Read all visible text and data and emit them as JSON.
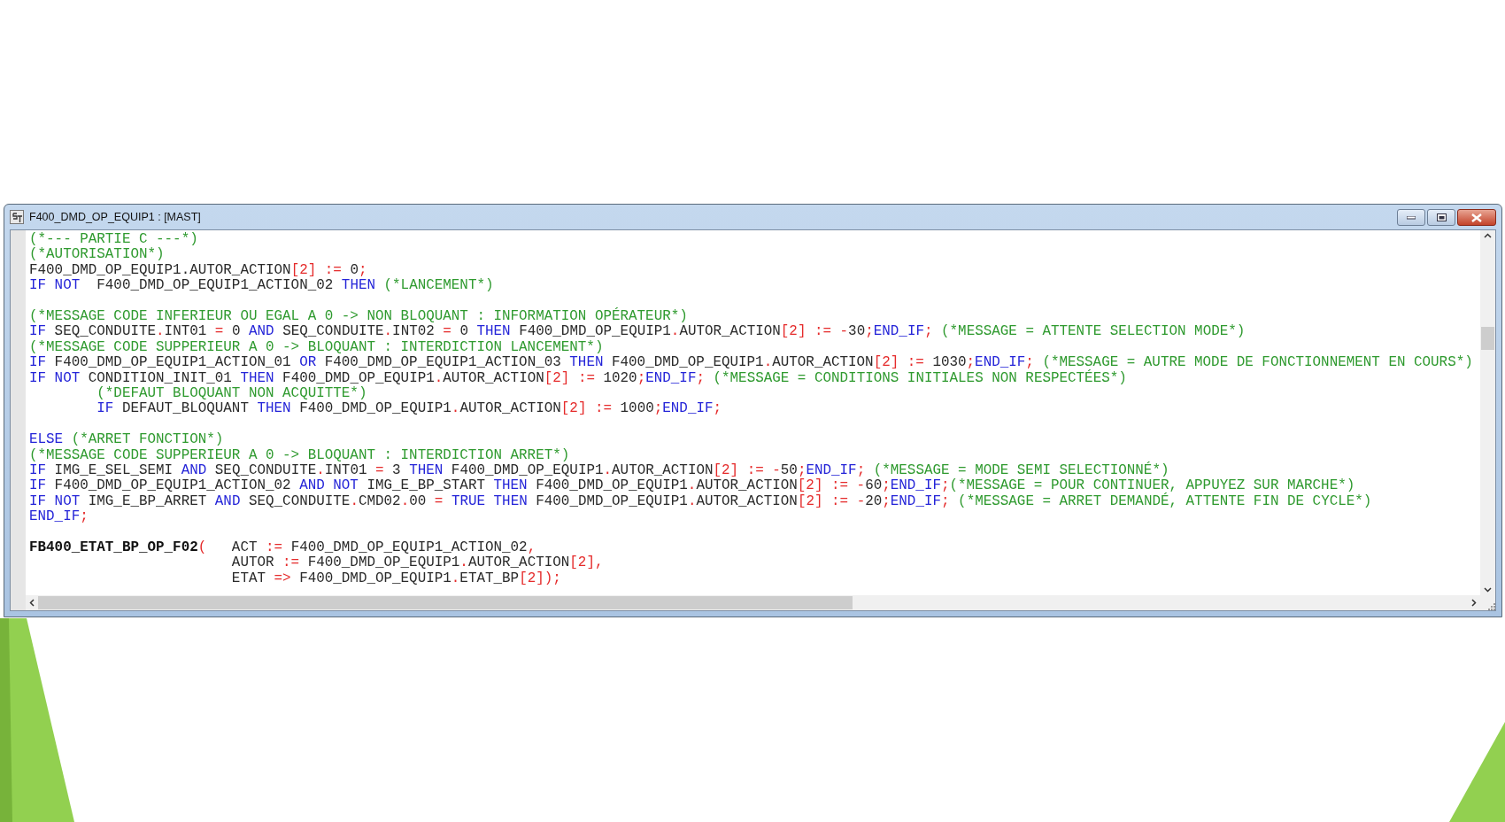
{
  "window": {
    "title": "F400_DMD_OP_EQUIP1 : [MAST]"
  },
  "editor": {
    "lines": [
      {
        "kind": "code",
        "tokens": [
          {
            "kind": "cm",
            "text": "(*--- PARTIE C ---*)"
          }
        ]
      },
      {
        "kind": "code",
        "tokens": [
          {
            "kind": "cm",
            "text": "(*AUTORISATION*)"
          }
        ]
      },
      {
        "kind": "code",
        "tokens": [
          {
            "kind": "id",
            "text": "F400_DMD_OP_EQUIP1.AUTOR_ACTION"
          },
          {
            "kind": "op",
            "text": "[2] := "
          },
          {
            "kind": "id",
            "text": "0"
          },
          {
            "kind": "op",
            "text": ";"
          }
        ]
      },
      {
        "kind": "code",
        "tokens": [
          {
            "kind": "kw",
            "text": "IF NOT  "
          },
          {
            "kind": "id",
            "text": "F400_DMD_OP_EQUIP1_ACTION_02 "
          },
          {
            "kind": "kw",
            "text": "THEN "
          },
          {
            "kind": "cm",
            "text": "(*LANCEMENT*)"
          }
        ]
      },
      {
        "kind": "blank"
      },
      {
        "kind": "code",
        "tokens": [
          {
            "kind": "cm",
            "text": "(*MESSAGE CODE INFERIEUR OU EGAL A 0 -> NON BLOQUANT : INFORMATION OPÉRATEUR*)"
          }
        ]
      },
      {
        "kind": "code",
        "tokens": [
          {
            "kind": "kw",
            "text": "IF "
          },
          {
            "kind": "id",
            "text": "SEQ_CONDUITE"
          },
          {
            "kind": "op",
            "text": "."
          },
          {
            "kind": "id",
            "text": "INT01 "
          },
          {
            "kind": "op",
            "text": "= "
          },
          {
            "kind": "id",
            "text": "0 "
          },
          {
            "kind": "kw",
            "text": "AND "
          },
          {
            "kind": "id",
            "text": "SEQ_CONDUITE"
          },
          {
            "kind": "op",
            "text": "."
          },
          {
            "kind": "id",
            "text": "INT02 "
          },
          {
            "kind": "op",
            "text": "= "
          },
          {
            "kind": "id",
            "text": "0 "
          },
          {
            "kind": "kw",
            "text": "THEN "
          },
          {
            "kind": "id",
            "text": "F400_DMD_OP_EQUIP1"
          },
          {
            "kind": "op",
            "text": "."
          },
          {
            "kind": "id",
            "text": "AUTOR_ACTION"
          },
          {
            "kind": "op",
            "text": "[2] := -"
          },
          {
            "kind": "id",
            "text": "30"
          },
          {
            "kind": "op",
            "text": ";"
          },
          {
            "kind": "kw",
            "text": "END_IF"
          },
          {
            "kind": "op",
            "text": "; "
          },
          {
            "kind": "cm",
            "text": "(*MESSAGE = ATTENTE SELECTION MODE*)"
          }
        ]
      },
      {
        "kind": "code",
        "tokens": [
          {
            "kind": "cm",
            "text": "(*MESSAGE CODE SUPPERIEUR A 0 -> BLOQUANT : INTERDICTION LANCEMENT*)"
          }
        ]
      },
      {
        "kind": "code",
        "tokens": [
          {
            "kind": "kw",
            "text": "IF "
          },
          {
            "kind": "id",
            "text": "F400_DMD_OP_EQUIP1_ACTION_01 "
          },
          {
            "kind": "kw",
            "text": "OR "
          },
          {
            "kind": "id",
            "text": "F400_DMD_OP_EQUIP1_ACTION_03 "
          },
          {
            "kind": "kw",
            "text": "THEN "
          },
          {
            "kind": "id",
            "text": "F400_DMD_OP_EQUIP1"
          },
          {
            "kind": "op",
            "text": "."
          },
          {
            "kind": "id",
            "text": "AUTOR_ACTION"
          },
          {
            "kind": "op",
            "text": "[2] := "
          },
          {
            "kind": "id",
            "text": "1030"
          },
          {
            "kind": "op",
            "text": ";"
          },
          {
            "kind": "kw",
            "text": "END_IF"
          },
          {
            "kind": "op",
            "text": "; "
          },
          {
            "kind": "cm",
            "text": "(*MESSAGE = AUTRE MODE DE FONCTIONNEMENT EN COURS*)"
          }
        ]
      },
      {
        "kind": "code",
        "tokens": [
          {
            "kind": "kw",
            "text": "IF NOT "
          },
          {
            "kind": "id",
            "text": "CONDITION_INIT_01 "
          },
          {
            "kind": "kw",
            "text": "THEN "
          },
          {
            "kind": "id",
            "text": "F400_DMD_OP_EQUIP1"
          },
          {
            "kind": "op",
            "text": "."
          },
          {
            "kind": "id",
            "text": "AUTOR_ACTION"
          },
          {
            "kind": "op",
            "text": "[2] := "
          },
          {
            "kind": "id",
            "text": "1020"
          },
          {
            "kind": "op",
            "text": ";"
          },
          {
            "kind": "kw",
            "text": "END_IF"
          },
          {
            "kind": "op",
            "text": "; "
          },
          {
            "kind": "cm",
            "text": "(*MESSAGE = CONDITIONS INITIALES NON RESPECTÉES*)"
          }
        ]
      },
      {
        "kind": "code",
        "tokens": [
          {
            "kind": "cm",
            "text": "        (*DEFAUT BLOQUANT NON ACQUITTE*)"
          }
        ]
      },
      {
        "kind": "code",
        "tokens": [
          {
            "kind": "kw",
            "text": "        IF "
          },
          {
            "kind": "id",
            "text": "DEFAUT_BLOQUANT "
          },
          {
            "kind": "kw",
            "text": "THEN "
          },
          {
            "kind": "id",
            "text": "F400_DMD_OP_EQUIP1"
          },
          {
            "kind": "op",
            "text": "."
          },
          {
            "kind": "id",
            "text": "AUTOR_ACTION"
          },
          {
            "kind": "op",
            "text": "[2] := "
          },
          {
            "kind": "id",
            "text": "1000"
          },
          {
            "kind": "op",
            "text": ";"
          },
          {
            "kind": "kw",
            "text": "END_IF"
          },
          {
            "kind": "op",
            "text": ";"
          }
        ]
      },
      {
        "kind": "blank"
      },
      {
        "kind": "code",
        "tokens": [
          {
            "kind": "kw",
            "text": "ELSE "
          },
          {
            "kind": "cm",
            "text": "(*ARRET FONCTION*)"
          }
        ]
      },
      {
        "kind": "code",
        "tokens": [
          {
            "kind": "cm",
            "text": "(*MESSAGE CODE SUPPERIEUR A 0 -> BLOQUANT : INTERDICTION ARRET*)"
          }
        ]
      },
      {
        "kind": "code",
        "tokens": [
          {
            "kind": "kw",
            "text": "IF "
          },
          {
            "kind": "id",
            "text": "IMG_E_SEL_SEMI "
          },
          {
            "kind": "kw",
            "text": "AND "
          },
          {
            "kind": "id",
            "text": "SEQ_CONDUITE"
          },
          {
            "kind": "op",
            "text": "."
          },
          {
            "kind": "id",
            "text": "INT01 "
          },
          {
            "kind": "op",
            "text": "= "
          },
          {
            "kind": "id",
            "text": "3 "
          },
          {
            "kind": "kw",
            "text": "THEN "
          },
          {
            "kind": "id",
            "text": "F400_DMD_OP_EQUIP1"
          },
          {
            "kind": "op",
            "text": "."
          },
          {
            "kind": "id",
            "text": "AUTOR_ACTION"
          },
          {
            "kind": "op",
            "text": "[2] := -"
          },
          {
            "kind": "id",
            "text": "50"
          },
          {
            "kind": "op",
            "text": ";"
          },
          {
            "kind": "kw",
            "text": "END_IF"
          },
          {
            "kind": "op",
            "text": "; "
          },
          {
            "kind": "cm",
            "text": "(*MESSAGE = MODE SEMI SELECTIONNÉ*)"
          }
        ]
      },
      {
        "kind": "code",
        "tokens": [
          {
            "kind": "kw",
            "text": "IF "
          },
          {
            "kind": "id",
            "text": "F400_DMD_OP_EQUIP1_ACTION_02 "
          },
          {
            "kind": "kw",
            "text": "AND NOT "
          },
          {
            "kind": "id",
            "text": "IMG_E_BP_START "
          },
          {
            "kind": "kw",
            "text": "THEN "
          },
          {
            "kind": "id",
            "text": "F400_DMD_OP_EQUIP1"
          },
          {
            "kind": "op",
            "text": "."
          },
          {
            "kind": "id",
            "text": "AUTOR_ACTION"
          },
          {
            "kind": "op",
            "text": "[2] := -"
          },
          {
            "kind": "id",
            "text": "60"
          },
          {
            "kind": "op",
            "text": ";"
          },
          {
            "kind": "kw",
            "text": "END_IF"
          },
          {
            "kind": "op",
            "text": ";"
          },
          {
            "kind": "cm",
            "text": "(*MESSAGE = POUR CONTINUER, APPUYEZ SUR MARCHE*)"
          }
        ]
      },
      {
        "kind": "code",
        "tokens": [
          {
            "kind": "kw",
            "text": "IF NOT "
          },
          {
            "kind": "id",
            "text": "IMG_E_BP_ARRET "
          },
          {
            "kind": "kw",
            "text": "AND "
          },
          {
            "kind": "id",
            "text": "SEQ_CONDUITE"
          },
          {
            "kind": "op",
            "text": "."
          },
          {
            "kind": "id",
            "text": "CMD02"
          },
          {
            "kind": "op",
            "text": "."
          },
          {
            "kind": "id",
            "text": "00 "
          },
          {
            "kind": "op",
            "text": "= "
          },
          {
            "kind": "kw",
            "text": "TRUE THEN "
          },
          {
            "kind": "id",
            "text": "F400_DMD_OP_EQUIP1"
          },
          {
            "kind": "op",
            "text": "."
          },
          {
            "kind": "id",
            "text": "AUTOR_ACTION"
          },
          {
            "kind": "op",
            "text": "[2] := -"
          },
          {
            "kind": "id",
            "text": "20"
          },
          {
            "kind": "op",
            "text": ";"
          },
          {
            "kind": "kw",
            "text": "END_IF"
          },
          {
            "kind": "op",
            "text": "; "
          },
          {
            "kind": "cm",
            "text": "(*MESSAGE = ARRET DEMANDÉ, ATTENTE FIN DE CYCLE*)"
          }
        ]
      },
      {
        "kind": "code",
        "tokens": [
          {
            "kind": "kw",
            "text": "END_IF"
          },
          {
            "kind": "op",
            "text": ";"
          }
        ]
      },
      {
        "kind": "blank"
      },
      {
        "kind": "code",
        "tokens": [
          {
            "kind": "fn",
            "text": "FB400_ETAT_BP_OP_F02"
          },
          {
            "kind": "op",
            "text": "("
          },
          {
            "kind": "id",
            "text": "   ACT "
          },
          {
            "kind": "op",
            "text": ":= "
          },
          {
            "kind": "id",
            "text": "F400_DMD_OP_EQUIP1_ACTION_02"
          },
          {
            "kind": "op",
            "text": ","
          }
        ]
      },
      {
        "kind": "code",
        "tokens": [
          {
            "kind": "id",
            "text": "                        AUTOR "
          },
          {
            "kind": "op",
            "text": ":= "
          },
          {
            "kind": "id",
            "text": "F400_DMD_OP_EQUIP1"
          },
          {
            "kind": "op",
            "text": "."
          },
          {
            "kind": "id",
            "text": "AUTOR_ACTION"
          },
          {
            "kind": "op",
            "text": "[2],"
          }
        ]
      },
      {
        "kind": "code",
        "tokens": [
          {
            "kind": "id",
            "text": "                        ETAT "
          },
          {
            "kind": "op",
            "text": "=> "
          },
          {
            "kind": "id",
            "text": "F400_DMD_OP_EQUIP1"
          },
          {
            "kind": "op",
            "text": "."
          },
          {
            "kind": "id",
            "text": "ETAT_BP"
          },
          {
            "kind": "op",
            "text": "[2]);"
          }
        ]
      }
    ]
  }
}
